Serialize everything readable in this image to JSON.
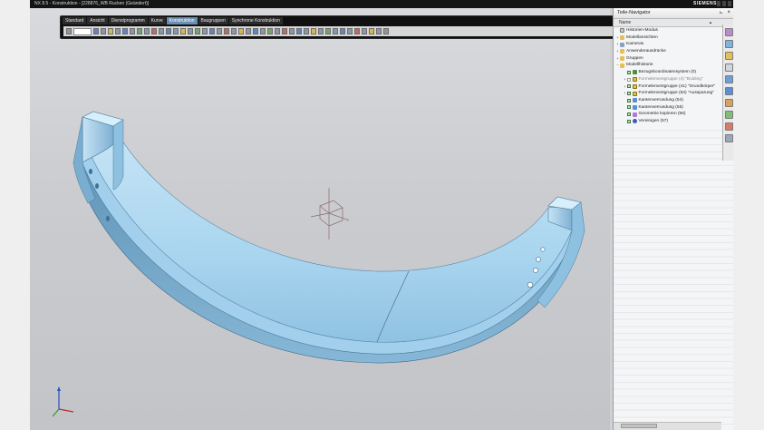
{
  "window": {
    "title": "NX 8.5 - Konstruktion - [228876_WB Rucken (Geändert)]",
    "brand": "SIEMENS"
  },
  "ribbon": {
    "tabs": [
      {
        "label": "Standard",
        "active": false
      },
      {
        "label": "Ansicht",
        "active": false
      },
      {
        "label": "Dienstprogramm",
        "active": false
      },
      {
        "label": "Kurve",
        "active": false
      },
      {
        "label": "Konstruktion",
        "active": true
      },
      {
        "label": "Baugruppen",
        "active": false
      },
      {
        "label": "Synchrone Konstruktion",
        "active": false
      }
    ]
  },
  "navigator": {
    "title": "Teile-Navigator",
    "column_name": "Name",
    "items": [
      {
        "label": "Historien-Modus",
        "icon": "sheet-icon",
        "level": 0
      },
      {
        "label": "Modellansichten",
        "icon": "folder-icon",
        "level": 0
      },
      {
        "label": "Kameras",
        "icon": "camera-icon",
        "level": 0
      },
      {
        "label": "Anwenderausdrücke",
        "icon": "folder-icon",
        "level": 0
      },
      {
        "label": "Gruppen",
        "icon": "folder-icon",
        "level": 0
      },
      {
        "label": "Modellhistorie",
        "icon": "folder-icon",
        "level": 0
      },
      {
        "label": "Bezugskoordinatensystem (0)",
        "icon": "csys-icon",
        "level": 1
      },
      {
        "label": "Formelementgruppe (4) \"Bulding\"",
        "icon": "feature-group-icon",
        "level": 1,
        "muted": true
      },
      {
        "label": "Formelementgruppe (41) \"Grundkörper\"",
        "icon": "feature-group-icon",
        "level": 1
      },
      {
        "label": "Formelementgruppe (53) \"Aussparung\"",
        "icon": "feature-group-icon",
        "level": 1
      },
      {
        "label": "Kantenverrundung (54)",
        "icon": "edge-blend-icon",
        "level": 1
      },
      {
        "label": "Kantenverrundung (55)",
        "icon": "edge-blend-icon",
        "level": 1
      },
      {
        "label": "Geometrie kopieren (56)",
        "icon": "copy-geometry-icon",
        "level": 1
      },
      {
        "label": "Vereinigen (57)",
        "icon": "unite-icon",
        "level": 1
      },
      {
        "label": "Kantenverrundung (58)",
        "icon": "edge-blend-icon",
        "level": 1
      },
      {
        "label": "Kantenverrundung (59)",
        "icon": "edge-blend-icon",
        "level": 1
      },
      {
        "label": "Fläche löschen (60)",
        "icon": "delete-face-icon",
        "level": 1
      },
      {
        "label": "Formelementgruppe (68) \"Hilfsgeometrie\"",
        "icon": "feature-group-icon",
        "level": 1,
        "selected": true
      }
    ]
  },
  "resource_bar": {
    "buttons": [
      "assembly-navigator-icon",
      "constraint-navigator-icon",
      "part-navigator-icon",
      "reuse-library-icon",
      "hd3d-tools-icon",
      "web-browser-icon",
      "history-icon",
      "process-studio-icon",
      "roles-icon",
      "system-scene-icon"
    ]
  },
  "colors": {
    "part_fill": "#9ecde9",
    "part_shadow": "#6a9cbd",
    "selection": "#2e73d2",
    "active_tab": "#6a8fb2"
  }
}
